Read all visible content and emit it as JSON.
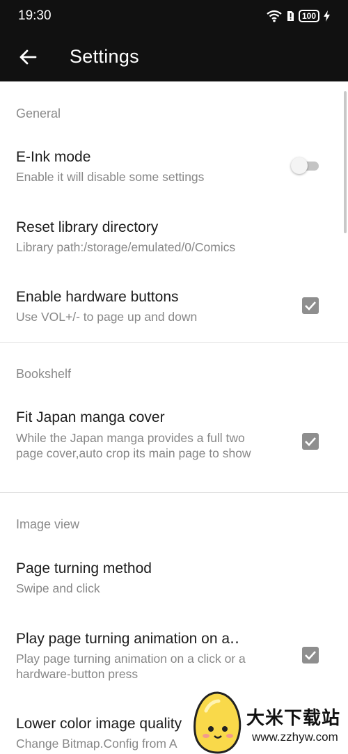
{
  "status_bar": {
    "time": "19:30",
    "battery": "100"
  },
  "app_bar": {
    "title": "Settings"
  },
  "sections": {
    "general": {
      "header": "General",
      "eink": {
        "title": "E-Ink mode",
        "summary": "Enable it will disable some settings",
        "enabled": false
      },
      "reset_dir": {
        "title": "Reset library directory",
        "summary": "Library path:/storage/emulated/0/Comics"
      },
      "hw_buttons": {
        "title": "Enable hardware buttons",
        "summary": "Use VOL+/- to page up and down",
        "checked": true
      }
    },
    "bookshelf": {
      "header": "Bookshelf",
      "fit_cover": {
        "title": "Fit Japan manga cover",
        "summary": "While the Japan manga provides a full two page cover,auto crop its main page to show",
        "checked": true
      }
    },
    "image_view": {
      "header": "Image view",
      "turning_method": {
        "title": "Page turning method",
        "summary": "Swipe and click"
      },
      "animation": {
        "title": "Play page turning animation on a‥",
        "summary": "Play page turning animation on a click or a hardware-button press",
        "checked": true
      },
      "lower_quality": {
        "title": "Lower color image quality",
        "summary": "Change Bitmap.Config from A"
      }
    }
  },
  "watermark": {
    "text": "大米下载站",
    "url": "www.zzhyw.com"
  },
  "colors": {
    "bar": "#111111",
    "checkbox": "#8e8e8e",
    "header": "#8a8a8a"
  }
}
